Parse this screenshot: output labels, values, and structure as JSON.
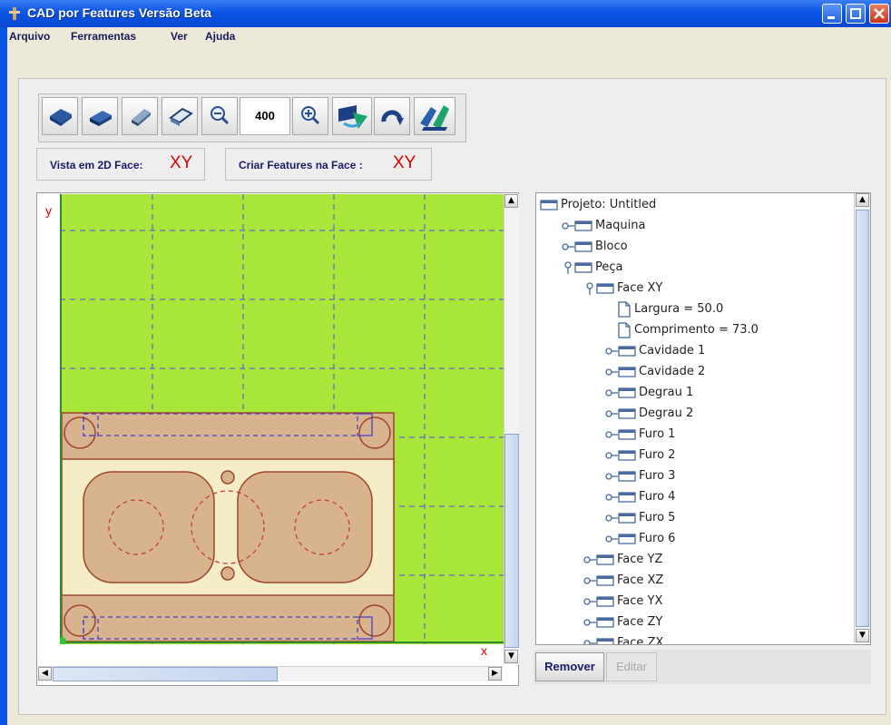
{
  "window": {
    "title": "CAD por Features Versão Beta"
  },
  "menu": [
    "Arquivo",
    "Ferramentas",
    "Ver",
    "Ajuda"
  ],
  "toolbar": {
    "zoom_value": "400",
    "buttons": [
      "view-top-icon",
      "view-front-icon",
      "view-side-icon",
      "view-wire-icon",
      "zoom-out-icon",
      "zoom-in-icon",
      "rotate-arrow-icon",
      "rotate-circle-icon",
      "axes-icon"
    ]
  },
  "info": {
    "vista_label": "Vista em 2D Face:",
    "vista_value": "XY",
    "criar_label": "Criar Features na Face :",
    "criar_value": "XY"
  },
  "canvas": {
    "axis_y": "y",
    "axis_x": "x",
    "background": "#a8e63a",
    "part_outer": "#d7b38e",
    "part_inner": "#f5ecc8",
    "outline": "#a0442a",
    "dashed": "#5a50d0"
  },
  "tree": [
    {
      "label": "Projeto: Untitled",
      "level": 0,
      "type": "folder",
      "expander": "none"
    },
    {
      "label": "Maquina",
      "level": 1,
      "type": "folder",
      "expander": "collapsed"
    },
    {
      "label": "Bloco",
      "level": 1,
      "type": "folder",
      "expander": "collapsed"
    },
    {
      "label": "Peça",
      "level": 1,
      "type": "folder",
      "expander": "expanded"
    },
    {
      "label": "Face XY",
      "level": 2,
      "type": "folder",
      "expander": "expanded"
    },
    {
      "label": "Largura = 50.0",
      "level": 3,
      "type": "doc",
      "expander": "none"
    },
    {
      "label": "Comprimento = 73.0",
      "level": 3,
      "type": "doc",
      "expander": "none"
    },
    {
      "label": "Cavidade 1",
      "level": 3,
      "type": "folder",
      "expander": "collapsed"
    },
    {
      "label": "Cavidade 2",
      "level": 3,
      "type": "folder",
      "expander": "collapsed"
    },
    {
      "label": "Degrau 1",
      "level": 3,
      "type": "folder",
      "expander": "collapsed"
    },
    {
      "label": "Degrau 2",
      "level": 3,
      "type": "folder",
      "expander": "collapsed"
    },
    {
      "label": "Furo 1",
      "level": 3,
      "type": "folder",
      "expander": "collapsed"
    },
    {
      "label": "Furo 2",
      "level": 3,
      "type": "folder",
      "expander": "collapsed"
    },
    {
      "label": "Furo 3",
      "level": 3,
      "type": "folder",
      "expander": "collapsed"
    },
    {
      "label": "Furo 4",
      "level": 3,
      "type": "folder",
      "expander": "collapsed"
    },
    {
      "label": "Furo 5",
      "level": 3,
      "type": "folder",
      "expander": "collapsed"
    },
    {
      "label": "Furo 6",
      "level": 3,
      "type": "folder",
      "expander": "collapsed"
    },
    {
      "label": "Face YZ",
      "level": 2,
      "type": "folder",
      "expander": "collapsed"
    },
    {
      "label": "Face XZ",
      "level": 2,
      "type": "folder",
      "expander": "collapsed"
    },
    {
      "label": "Face YX",
      "level": 2,
      "type": "folder",
      "expander": "collapsed"
    },
    {
      "label": "Face ZY",
      "level": 2,
      "type": "folder",
      "expander": "collapsed"
    },
    {
      "label": "Face ZX",
      "level": 2,
      "type": "folder",
      "expander": "collapsed"
    }
  ],
  "buttons": {
    "remover": "Remover",
    "editar": "Editar"
  }
}
